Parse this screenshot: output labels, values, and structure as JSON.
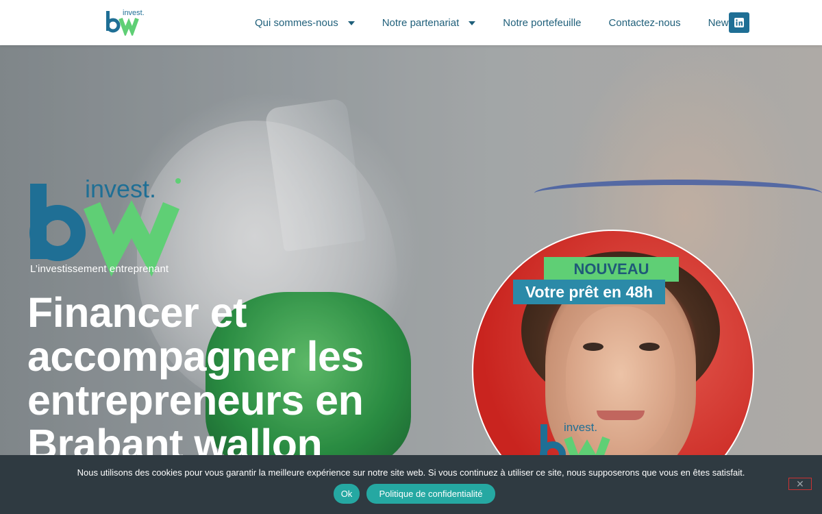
{
  "header": {
    "logo_text_small": "invest.",
    "logo_letters": "bw",
    "nav": [
      {
        "label": "Qui sommes-nous",
        "has_dropdown": true
      },
      {
        "label": "Notre partenariat",
        "has_dropdown": true
      },
      {
        "label": "Notre portefeuille",
        "has_dropdown": false
      },
      {
        "label": "Contactez-nous",
        "has_dropdown": false
      },
      {
        "label": "News",
        "has_dropdown": false
      }
    ],
    "social_icon": "linkedin-icon"
  },
  "hero": {
    "logo_invest": "invest.",
    "tagline": "L’investissement entreprenant",
    "headline": "Financer et accompagner les entrepreneurs en Brabant wallon"
  },
  "promo": {
    "badge_new": "NOUVEAU",
    "badge_loan": "Votre prêt en 48h",
    "logo_invest": "invest."
  },
  "cookie": {
    "text": "Nous utilisons des cookies pour vous garantir la meilleure expérience sur notre site web. Si vous continuez à utiliser ce site, nous supposerons que vous en êtes satisfait.",
    "ok_label": "Ok",
    "privacy_label": "Politique de confidentialité",
    "close_icon": "close-icon"
  },
  "colors": {
    "brand_blue": "#1f6f95",
    "brand_green": "#5fcf75",
    "nav_text": "#1f5f7a",
    "cookie_bg": "#2f3a41",
    "cookie_button": "#25a8a2"
  }
}
